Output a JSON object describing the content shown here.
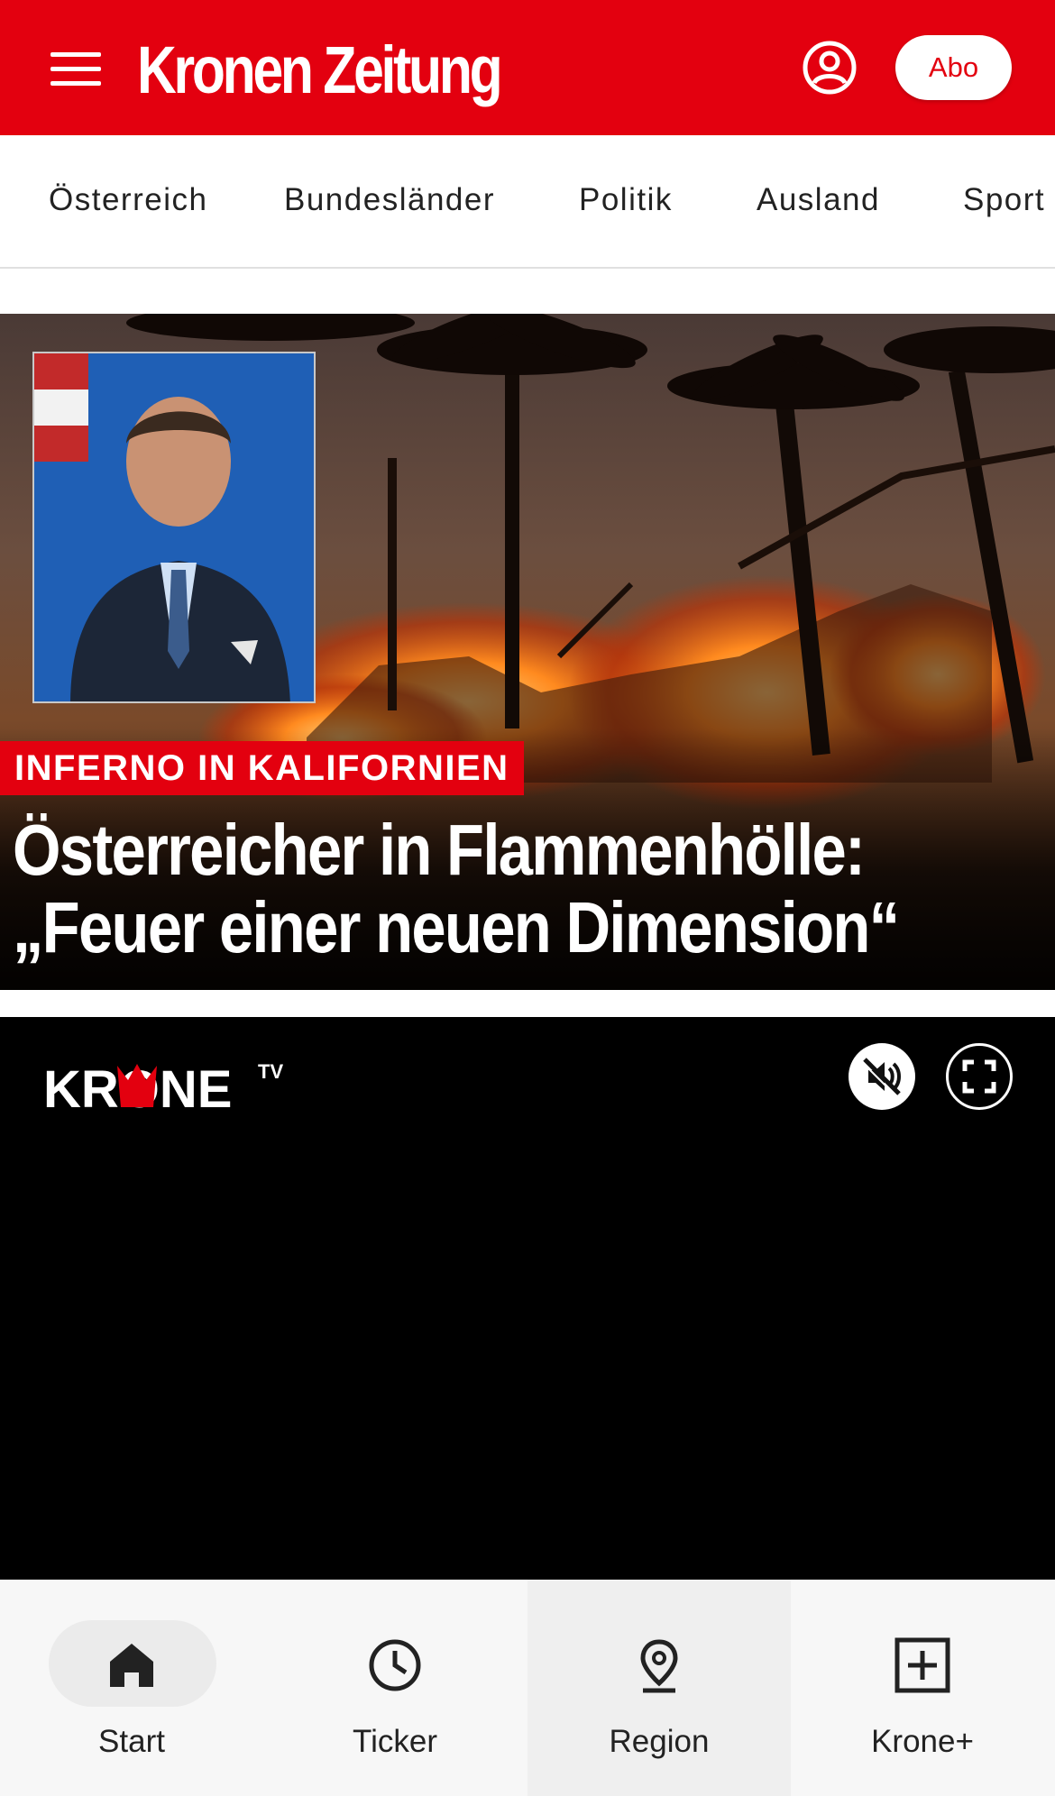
{
  "header": {
    "logo_text": "Kronen Zeitung",
    "abo_label": "Abo",
    "brand_color": "#e3000f",
    "menu_icon": "hamburger-menu-icon",
    "user_icon": "user-account-icon"
  },
  "nav": {
    "items": [
      {
        "label": "Österreich"
      },
      {
        "label": "Bundesländer"
      },
      {
        "label": "Politik"
      },
      {
        "label": "Ausland"
      },
      {
        "label": "Sport"
      }
    ]
  },
  "hero": {
    "kicker": "INFERNO IN KALIFORNIEN",
    "headline_line1": "Österreicher in Flammenhölle:",
    "headline_line2": "„Feuer einer neuen Dimension“"
  },
  "video": {
    "logo_text": "KRONE",
    "logo_superscript": "TV",
    "mute_icon": "volume-muted-icon",
    "fullscreen_icon": "fullscreen-icon"
  },
  "bottom_nav": {
    "tabs": [
      {
        "label": "Start",
        "icon": "home-icon"
      },
      {
        "label": "Ticker",
        "icon": "clock-icon"
      },
      {
        "label": "Region",
        "icon": "location-pin-icon"
      },
      {
        "label": "Krone+",
        "icon": "plus-box-icon"
      }
    ]
  }
}
